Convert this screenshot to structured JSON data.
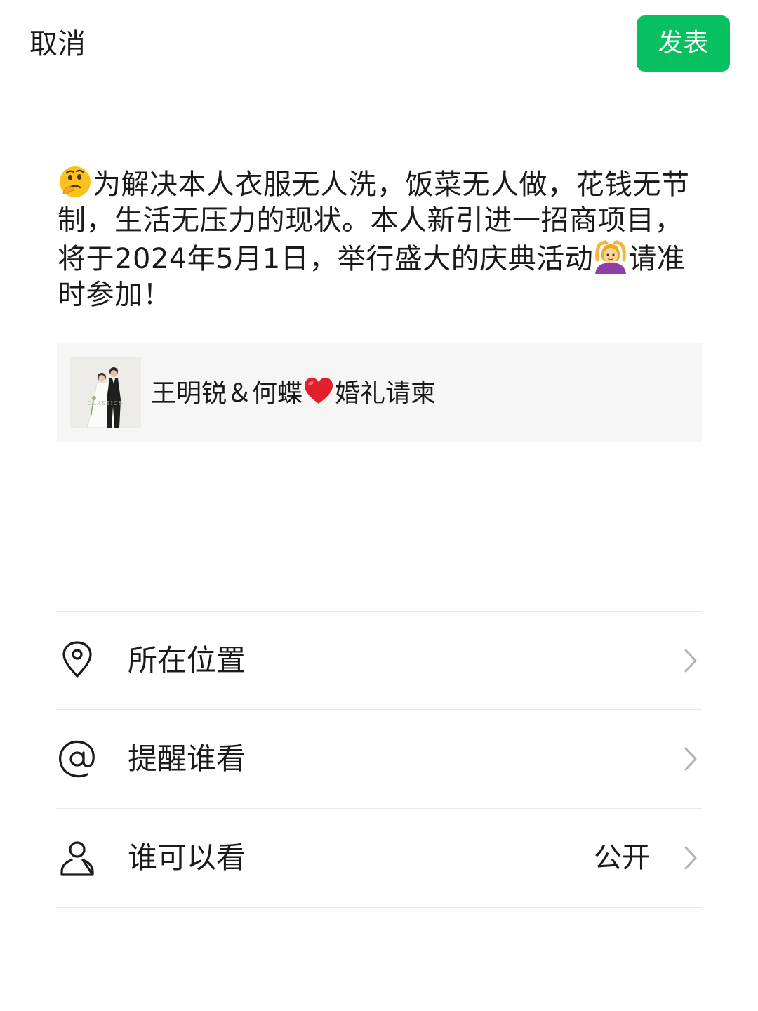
{
  "header": {
    "cancel_label": "取消",
    "publish_label": "发表",
    "publish_color": "#07c160"
  },
  "post": {
    "leading_emoji": "thinking-face-emoji",
    "text_part1": "为解决本人衣服无人洗，饭菜无人做，花钱无节制，生活无压力的现状。本人新引进一招商项目，将于2024年5月1日，举行盛大的庆典活动",
    "inline_emoji": "person-gesturing-ok-emoji",
    "text_part2": "请准时参加！"
  },
  "link_card": {
    "thumbnail": "wedding-photo-thumbnail",
    "title_part1": "王明锐＆何蝶",
    "title_emoji": "red-heart-emoji",
    "title_part2": "婚礼请柬"
  },
  "options": [
    {
      "icon": "location-pin-icon",
      "label": "所在位置",
      "value": ""
    },
    {
      "icon": "at-sign-icon",
      "label": "提醒谁看",
      "value": ""
    },
    {
      "icon": "person-icon",
      "label": "谁可以看",
      "value": "公开"
    }
  ]
}
